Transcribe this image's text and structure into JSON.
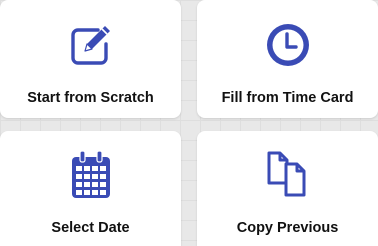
{
  "accent_color": "#3a4bb5",
  "tiles": [
    {
      "label": "Start from Scratch",
      "icon": "edit-pencil-icon"
    },
    {
      "label": "Fill from Time Card",
      "icon": "clock-icon"
    },
    {
      "label": "Select Date",
      "icon": "calendar-icon"
    },
    {
      "label": "Copy Previous",
      "icon": "copy-documents-icon"
    }
  ]
}
